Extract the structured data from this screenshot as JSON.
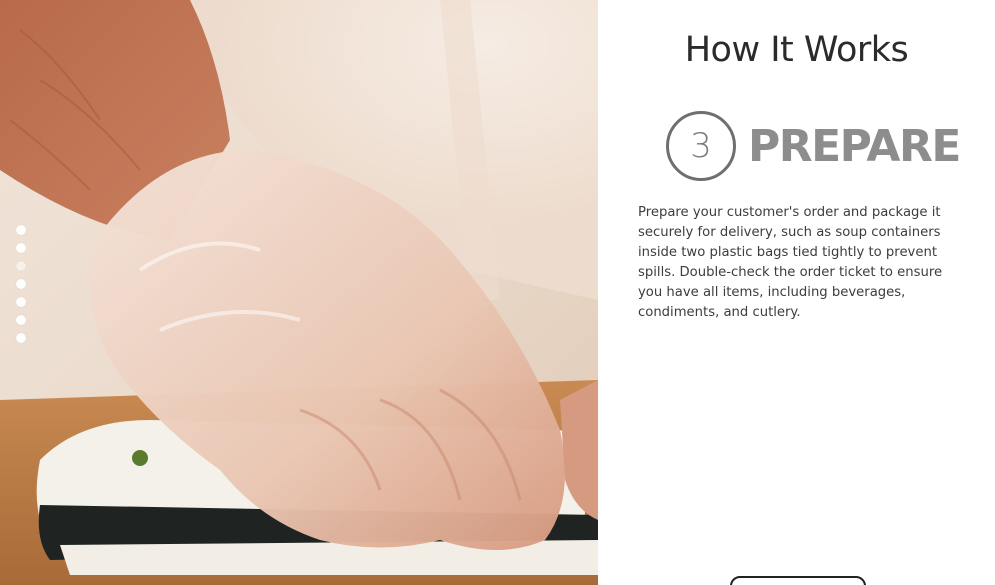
{
  "hero_image": {
    "alt_icon": "sushi-rolling-photo"
  },
  "pager": {
    "count": 7,
    "active_index": 2
  },
  "section": {
    "title": "How It Works",
    "step_number": "3",
    "step_name": "PREPARE",
    "description": "Prepare your customer's order and package it securely for delivery, such as soup containers inside two plastic bags tied tightly to prevent spills. Double-check the order ticket to ensure you have all items, including beverages, condiments, and cutlery."
  },
  "colors": {
    "title": "#2b2b2b",
    "step_circle": "#6f6f6f",
    "step_name": "#8d8d8d",
    "body_text": "#3d3d3d"
  }
}
